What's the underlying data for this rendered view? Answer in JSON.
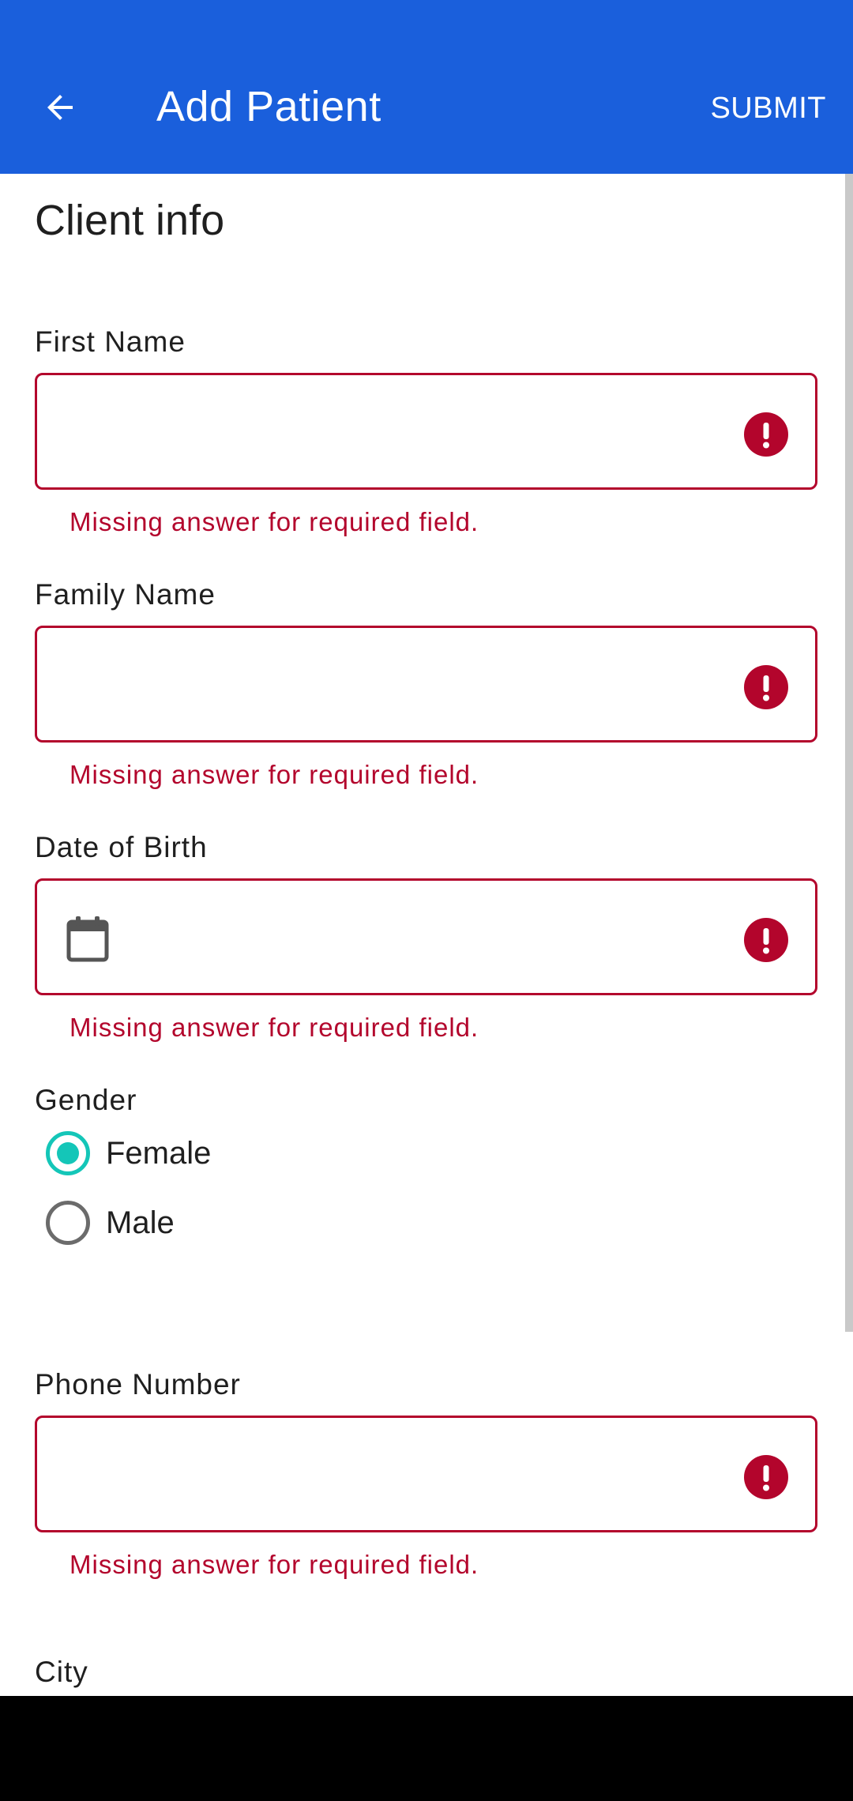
{
  "appbar": {
    "title": "Add Patient",
    "submit_label": "SUBMIT",
    "back_icon": "arrow-back-icon",
    "background_color": "#1a5fdc"
  },
  "form": {
    "section_title": "Client info",
    "fields": {
      "first_name": {
        "label": "First Name",
        "value": "",
        "error": "Missing answer for required field."
      },
      "family_name": {
        "label": "Family Name",
        "value": "",
        "error": "Missing answer for required field."
      },
      "date_of_birth": {
        "label": "Date of Birth",
        "value": "",
        "error": "Missing answer for required field.",
        "icon": "calendar-icon"
      },
      "gender": {
        "label": "Gender",
        "options": [
          "Female",
          "Male"
        ],
        "selected": "Female"
      },
      "phone_number": {
        "label": "Phone Number",
        "value": "",
        "error": "Missing answer for required field."
      },
      "city": {
        "label": "City"
      }
    }
  },
  "colors": {
    "error": "#b3052c",
    "radio_selected": "#14c6b8",
    "radio_unselected": "#6b6b6b"
  }
}
